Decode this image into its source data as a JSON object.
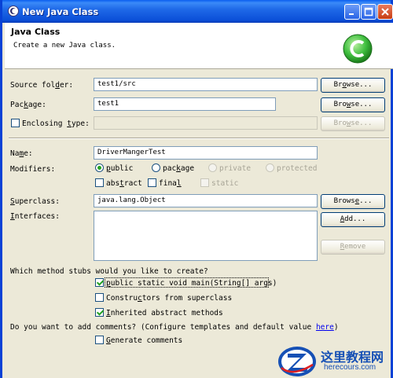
{
  "window": {
    "title": "New Java Class"
  },
  "header": {
    "title": "Java Class",
    "description": "Create a new Java class."
  },
  "source_folder": {
    "label_pre": "Source fol",
    "label_acc": "d",
    "label_post": "er:",
    "value": "test1/src",
    "browse_pre": "Br",
    "browse_acc": "o",
    "browse_post": "wse..."
  },
  "package": {
    "label_pre": "Pac",
    "label_acc": "k",
    "label_post": "age:",
    "value": "test1",
    "browse_pre": "Bro",
    "browse_acc": "w",
    "browse_post": "se..."
  },
  "enclosing_type": {
    "label_pre": "Enclosing ",
    "label_acc": "t",
    "label_post": "ype:",
    "value": "",
    "browse_pre": "Bro",
    "browse_acc": "w",
    "browse_post": "se..."
  },
  "name": {
    "label_pre": "Na",
    "label_acc": "m",
    "label_post": "e:",
    "value": "DriverMangerTest"
  },
  "modifiers": {
    "label": "Modifiers:",
    "public_pre": "",
    "public_acc": "p",
    "public_post": "ublic",
    "package_pre": "pac",
    "package_acc": "k",
    "package_post": "age",
    "private": "private",
    "protected": "protected",
    "abstract_pre": "abs",
    "abstract_acc": "t",
    "abstract_post": "ract",
    "final_pre": "fina",
    "final_acc": "l",
    "final_post": "",
    "static": "static"
  },
  "superclass": {
    "label_pre": "",
    "label_acc": "S",
    "label_post": "uperclass:",
    "value": "java.lang.Object",
    "browse_pre": "Brows",
    "browse_acc": "e",
    "browse_post": "..."
  },
  "interfaces": {
    "label_pre": "",
    "label_acc": "I",
    "label_post": "nterfaces:",
    "add_pre": "",
    "add_acc": "A",
    "add_post": "dd...",
    "remove_pre": "",
    "remove_acc": "R",
    "remove_post": "emove"
  },
  "stubs": {
    "question": "Which method stubs would you like to create?",
    "main_pre": "",
    "main_acc": "p",
    "main_post": "ublic static void main(String[] args)",
    "ctors_pre": "Constru",
    "ctors_acc": "c",
    "ctors_post": "tors from superclass",
    "inherited_pre": "",
    "inherited_acc": "I",
    "inherited_post": "nherited abstract methods"
  },
  "comments": {
    "question": "Do you want to add comments? (Configure templates and default value ",
    "link": "here",
    "question_end": ")",
    "generate_pre": "",
    "generate_acc": "G",
    "generate_post": "enerate comments"
  },
  "watermark": {
    "title": "这里教程网",
    "url": "herecours.com"
  },
  "colors": {
    "title_blue": "#0a5ef0",
    "check_green": "#21a121",
    "logo_green": "#3fbf3f"
  }
}
